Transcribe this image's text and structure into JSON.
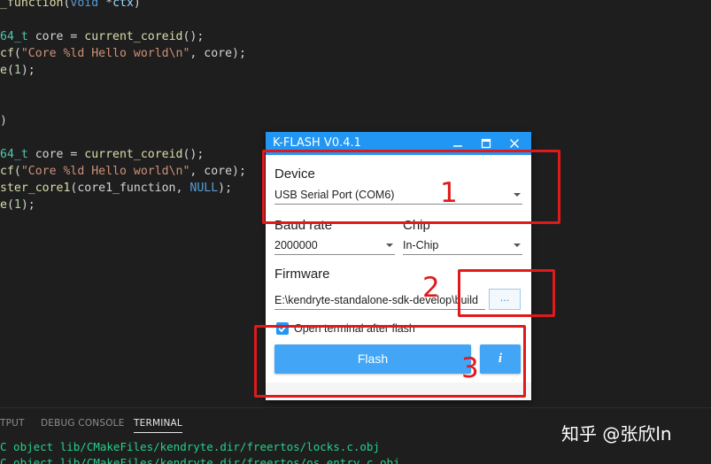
{
  "editor": {
    "lines": [
      {
        "parts": [
          {
            "c": "k",
            "t": "_function"
          },
          {
            "c": "",
            "t": "("
          },
          {
            "c": "b",
            "t": "void"
          },
          {
            "c": "",
            "t": " *"
          },
          {
            "c": "v",
            "t": "ctx"
          },
          {
            "c": "",
            "t": ")"
          }
        ]
      },
      {
        "parts": []
      },
      {
        "parts": [
          {
            "c": "t",
            "t": "64_t"
          },
          {
            "c": "",
            "t": " core = "
          },
          {
            "c": "k",
            "t": "current_coreid"
          },
          {
            "c": "",
            "t": "();"
          }
        ]
      },
      {
        "parts": [
          {
            "c": "k",
            "t": "cf"
          },
          {
            "c": "",
            "t": "("
          },
          {
            "c": "s",
            "t": "\"Core %ld Hello world\\n\""
          },
          {
            "c": "",
            "t": ", core);"
          }
        ]
      },
      {
        "parts": [
          {
            "c": "k",
            "t": "e"
          },
          {
            "c": "",
            "t": "("
          },
          {
            "c": "n",
            "t": "1"
          },
          {
            "c": "",
            "t": ");"
          }
        ]
      },
      {
        "parts": []
      },
      {
        "parts": []
      },
      {
        "parts": [
          {
            "c": "",
            "t": ")"
          }
        ]
      },
      {
        "parts": []
      },
      {
        "parts": [
          {
            "c": "t",
            "t": "64_t"
          },
          {
            "c": "",
            "t": " core = "
          },
          {
            "c": "k",
            "t": "current_coreid"
          },
          {
            "c": "",
            "t": "();"
          }
        ]
      },
      {
        "parts": [
          {
            "c": "k",
            "t": "cf"
          },
          {
            "c": "",
            "t": "("
          },
          {
            "c": "s",
            "t": "\"Core %ld Hello world\\n\""
          },
          {
            "c": "",
            "t": ", core);"
          }
        ]
      },
      {
        "parts": [
          {
            "c": "k",
            "t": "ster_core1"
          },
          {
            "c": "",
            "t": "(core1_function, "
          },
          {
            "c": "b",
            "t": "NULL"
          },
          {
            "c": "",
            "t": ");"
          }
        ]
      },
      {
        "parts": [
          {
            "c": "k",
            "t": "e"
          },
          {
            "c": "",
            "t": "("
          },
          {
            "c": "n",
            "t": "1"
          },
          {
            "c": "",
            "t": ");"
          }
        ]
      }
    ]
  },
  "panel": {
    "tabs": [
      "TPUT",
      "DEBUG CONSOLE",
      "TERMINAL"
    ],
    "active_tab": "TERMINAL",
    "terminal_lines": [
      "C object lib/CMakeFiles/kendryte.dir/freertos/locks.c.obj",
      "C object lib/CMakeFiles/kendryte.dir/freertos/os_entry.c.obj"
    ]
  },
  "kflash": {
    "title": "K-FLASH V0.4.1",
    "device_label": "Device",
    "device_value": "USB Serial Port (COM6)",
    "baud_label": "Baud rate",
    "baud_value": "2000000",
    "chip_label": "Chip",
    "chip_value": "In-Chip",
    "firmware_label": "Firmware",
    "firmware_path": "E:\\kendryte-standalone-sdk-develop\\build",
    "browse_label": "...",
    "checkbox_label": "Open terminal after flash",
    "checkbox_checked": true,
    "flash_label": "Flash",
    "info_label": "i",
    "accent_color": "#2196f3"
  },
  "annotations": {
    "numbers": [
      "1",
      "2",
      "3"
    ],
    "color": "#e0191c"
  },
  "watermark": "知乎 @张欣ln"
}
